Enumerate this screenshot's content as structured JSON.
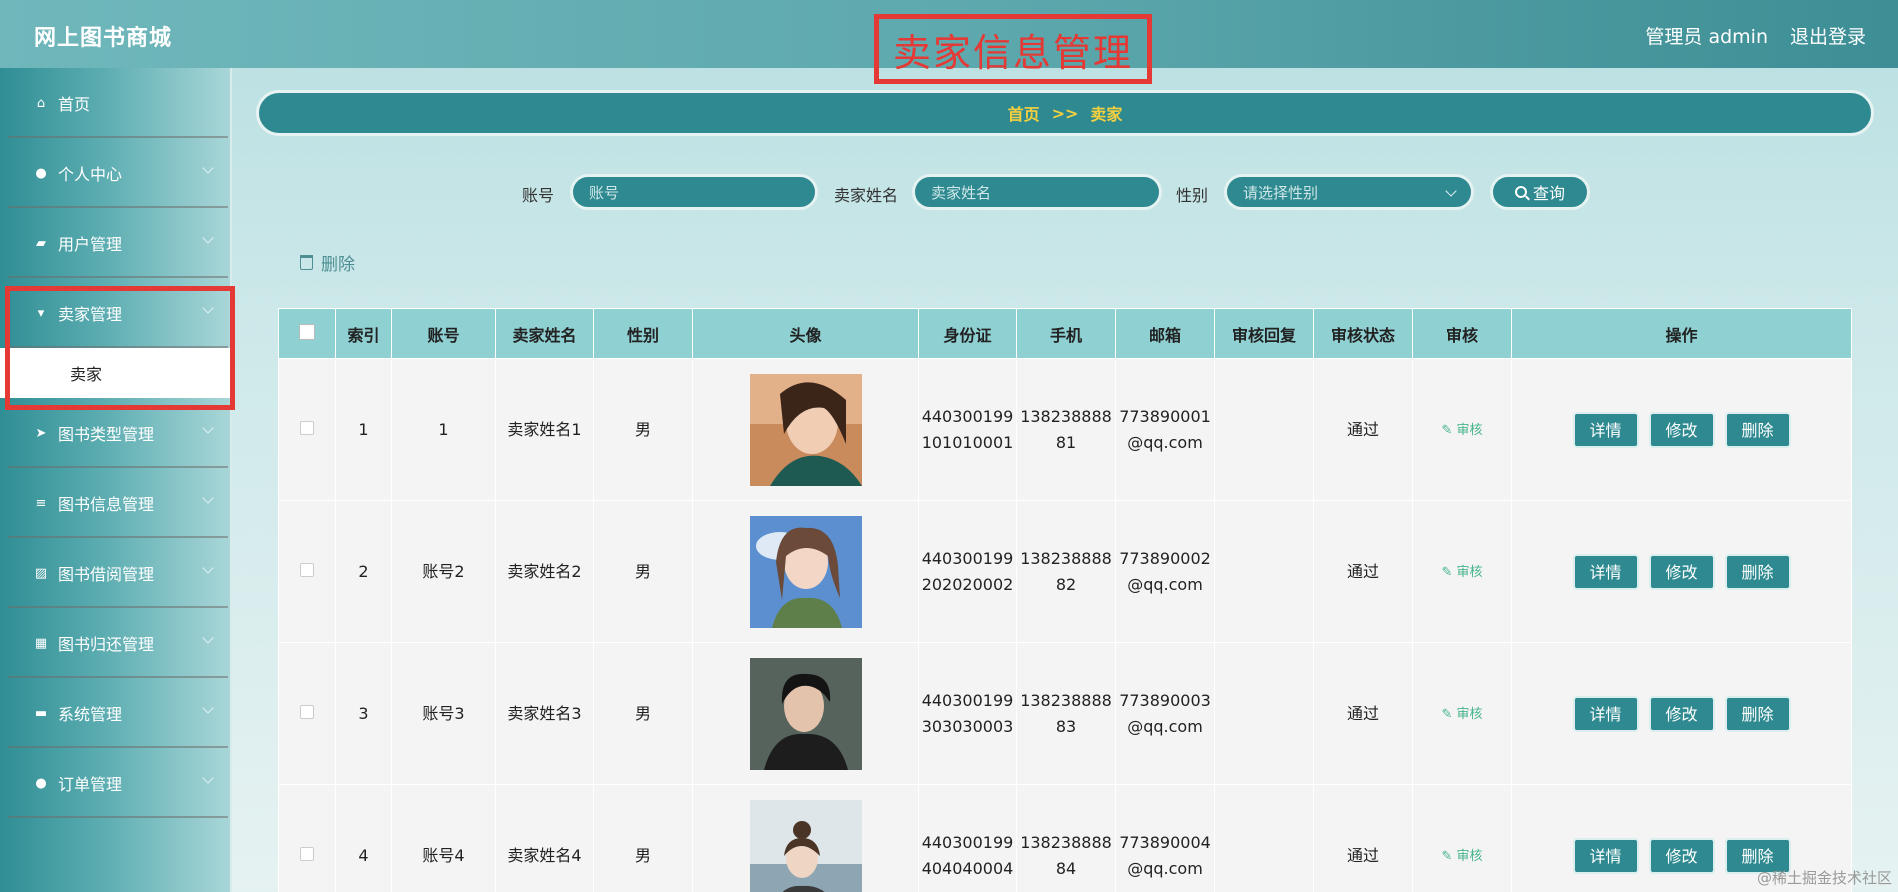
{
  "app": {
    "title": "网上图书商城",
    "user_label": "管理员 admin",
    "logout": "退出登录"
  },
  "page_title": "卖家信息管理",
  "breadcrumb": {
    "home": "首页",
    "sep": ">>",
    "current": "卖家"
  },
  "sidebar": {
    "items": [
      {
        "label": "首页",
        "icon": "home-icon"
      },
      {
        "label": "个人中心",
        "icon": "user-icon"
      },
      {
        "label": "用户管理",
        "icon": "users-icon"
      },
      {
        "label": "卖家管理",
        "icon": "flag-icon",
        "expanded": true,
        "sub": "卖家"
      },
      {
        "label": "图书类型管理",
        "icon": "send-icon"
      },
      {
        "label": "图书信息管理",
        "icon": "list-icon"
      },
      {
        "label": "图书借阅管理",
        "icon": "chart-icon"
      },
      {
        "label": "图书归还管理",
        "icon": "grid-icon"
      },
      {
        "label": "系统管理",
        "icon": "ticket-icon"
      },
      {
        "label": "订单管理",
        "icon": "pin-icon"
      }
    ]
  },
  "search": {
    "account_label": "账号",
    "account_placeholder": "账号",
    "name_label": "卖家姓名",
    "name_placeholder": "卖家姓名",
    "gender_label": "性别",
    "gender_placeholder": "请选择性别",
    "query_button": "查询"
  },
  "toolbar": {
    "delete_label": "删除"
  },
  "table": {
    "headers": [
      "索引",
      "账号",
      "卖家姓名",
      "性别",
      "头像",
      "身份证",
      "手机",
      "邮箱",
      "审核回复",
      "审核状态",
      "审核",
      "操作"
    ],
    "rows": [
      {
        "index": "1",
        "account": "1",
        "name": "卖家姓名1",
        "gender": "男",
        "id_card": "440300199101010001",
        "phone": "13823888881",
        "email": "773890001@qq.com",
        "reply": "",
        "status": "通过"
      },
      {
        "index": "2",
        "account": "账号2",
        "name": "卖家姓名2",
        "gender": "男",
        "id_card": "440300199202020002",
        "phone": "13823888882",
        "email": "773890002@qq.com",
        "reply": "",
        "status": "通过"
      },
      {
        "index": "3",
        "account": "账号3",
        "name": "卖家姓名3",
        "gender": "男",
        "id_card": "440300199303030003",
        "phone": "13823888883",
        "email": "773890003@qq.com",
        "reply": "",
        "status": "通过"
      },
      {
        "index": "4",
        "account": "账号4",
        "name": "卖家姓名4",
        "gender": "男",
        "id_card": "440300199404040004",
        "phone": "13823888884",
        "email": "773890004@qq.com",
        "reply": "",
        "status": "通过"
      }
    ],
    "audit_link": "审核",
    "actions": {
      "detail": "详情",
      "edit": "修改",
      "delete": "删除"
    }
  },
  "watermark": "@稀土掘金技术社区"
}
